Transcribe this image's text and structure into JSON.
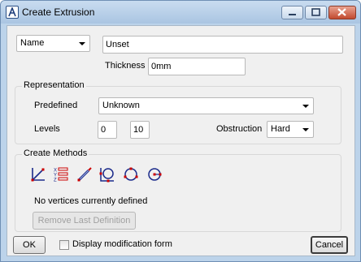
{
  "window": {
    "title": "Create Extrusion"
  },
  "header": {
    "name_dropdown": {
      "value": "Name"
    },
    "name_input": {
      "value": "Unset"
    },
    "thickness_label": "Thickness",
    "thickness_input": {
      "value": "0mm"
    }
  },
  "representation": {
    "group_title": "Representation",
    "predefined_label": "Predefined",
    "predefined_value": "Unknown",
    "levels_label": "Levels",
    "levels_from": "0",
    "levels_to": "10",
    "obstruction_label": "Obstruction",
    "obstruction_value": "Hard"
  },
  "create_methods": {
    "group_title": "Create Methods",
    "icons": [
      "line-draw-icon",
      "xyz-coordinates-icon",
      "pencil-draw-icon",
      "circle-tangent-icon",
      "circle-three-point-icon",
      "circle-center-radius-icon"
    ],
    "status_text": "No vertices currently defined",
    "remove_button_label": "Remove Last Definition"
  },
  "footer": {
    "ok_label": "OK",
    "display_modification_label": "Display modification form",
    "display_modification_checked": false,
    "cancel_label": "Cancel"
  },
  "colors": {
    "titlebar": "#bcd3ea",
    "dialog_bg": "#f0f0f0",
    "icon_blue": "#1a2a8a",
    "icon_red": "#cc0000"
  }
}
